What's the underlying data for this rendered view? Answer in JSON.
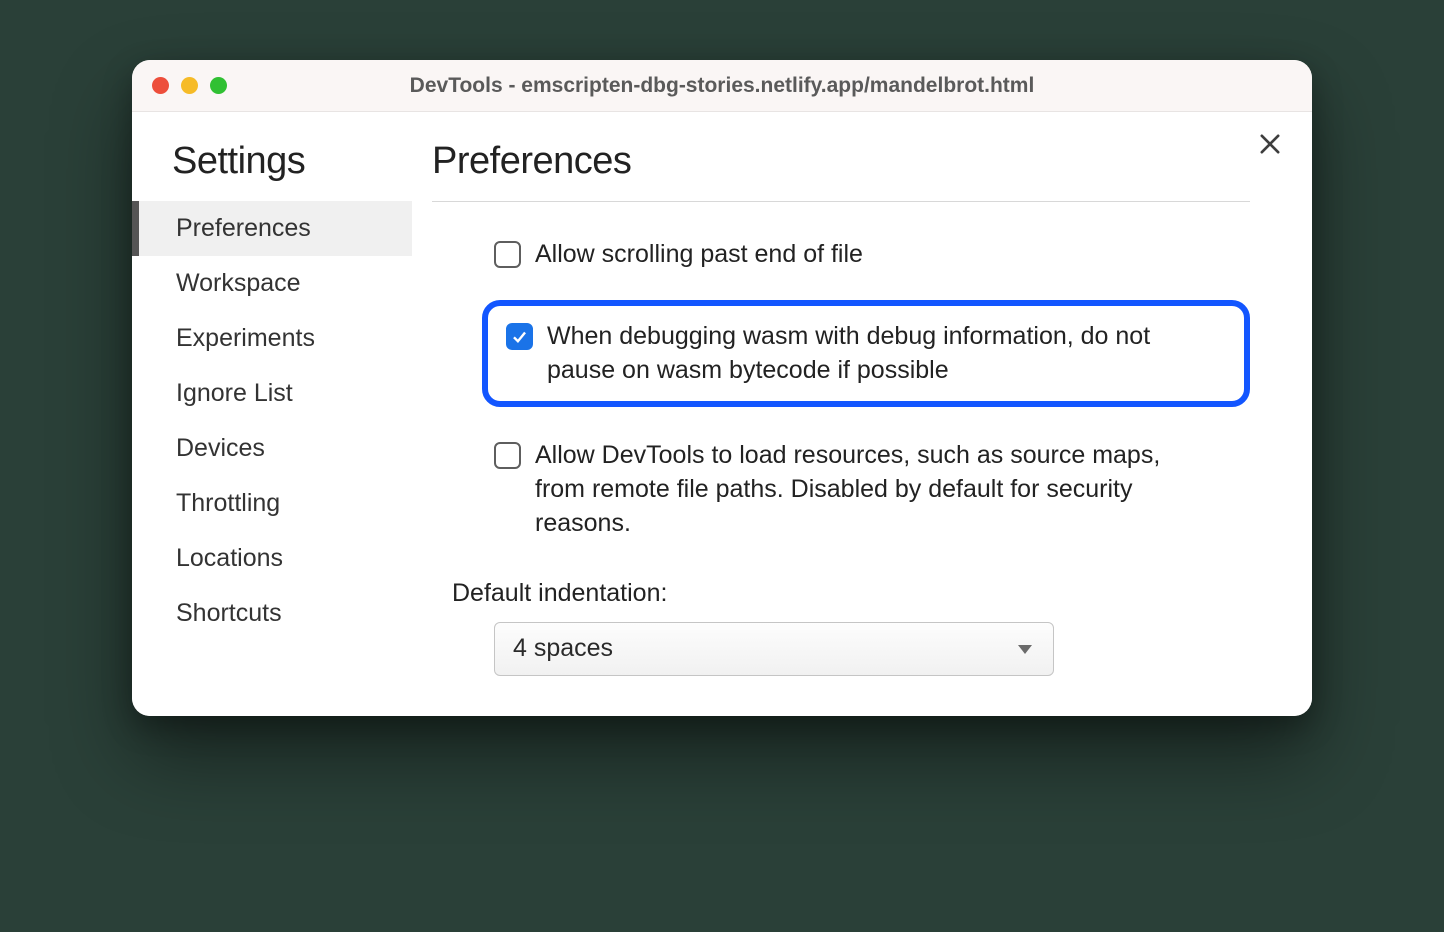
{
  "window": {
    "title": "DevTools - emscripten-dbg-stories.netlify.app/mandelbrot.html"
  },
  "sidebar": {
    "title": "Settings",
    "items": [
      {
        "label": "Preferences",
        "active": true
      },
      {
        "label": "Workspace",
        "active": false
      },
      {
        "label": "Experiments",
        "active": false
      },
      {
        "label": "Ignore List",
        "active": false
      },
      {
        "label": "Devices",
        "active": false
      },
      {
        "label": "Throttling",
        "active": false
      },
      {
        "label": "Locations",
        "active": false
      },
      {
        "label": "Shortcuts",
        "active": false
      }
    ]
  },
  "content": {
    "title": "Preferences",
    "checkboxes": [
      {
        "label": "Allow scrolling past end of file",
        "checked": false,
        "highlighted": false
      },
      {
        "label": "When debugging wasm with debug information, do not pause on wasm bytecode if possible",
        "checked": true,
        "highlighted": true
      },
      {
        "label": "Allow DevTools to load resources, such as source maps, from remote file paths. Disabled by default for security reasons.",
        "checked": false,
        "highlighted": false
      }
    ],
    "indentation": {
      "label": "Default indentation:",
      "value": "4 spaces"
    }
  }
}
